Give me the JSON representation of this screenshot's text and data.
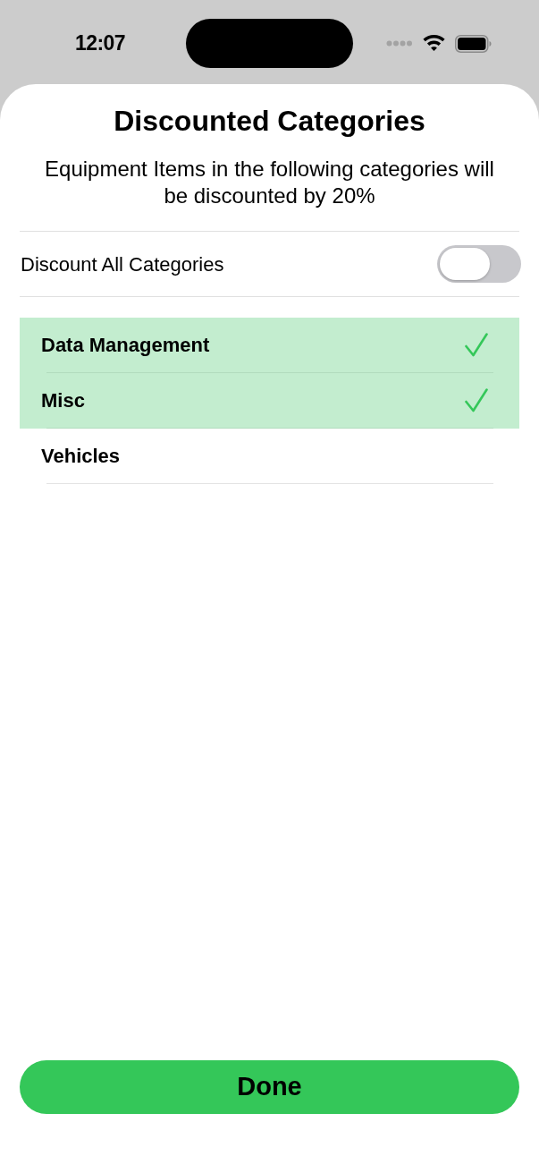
{
  "status_bar": {
    "time": "12:07"
  },
  "sheet": {
    "title": "Discounted Categories",
    "subtitle": "Equipment Items in the following categories will be discounted by 20%"
  },
  "discount_all": {
    "label": "Discount All Categories",
    "on": false
  },
  "categories": [
    {
      "label": "Data Management",
      "selected": true
    },
    {
      "label": "Misc",
      "selected": true
    },
    {
      "label": "Vehicles",
      "selected": false
    }
  ],
  "buttons": [
    {
      "label": "Done"
    }
  ]
}
